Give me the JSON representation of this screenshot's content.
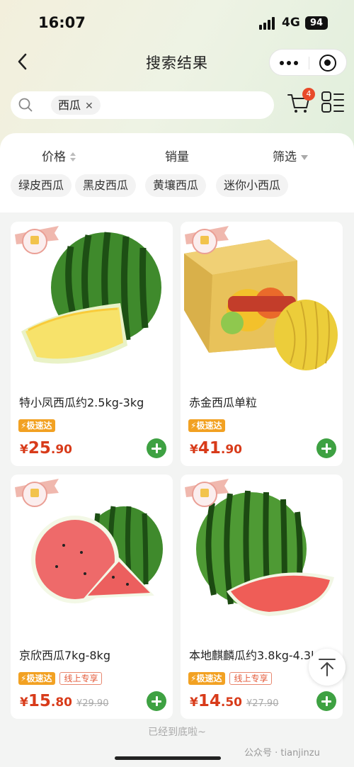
{
  "status": {
    "time": "16:07",
    "network": "4G",
    "battery": "94"
  },
  "nav": {
    "title": "搜索结果",
    "back_icon": "chevron-left-icon",
    "more_icon": "more-dots-icon",
    "close_icon": "target-close-icon"
  },
  "search": {
    "keyword": "西瓜",
    "clear_glyph": "✕",
    "icon": "search-icon"
  },
  "cart": {
    "badge": "4",
    "icon": "cart-icon"
  },
  "sort": {
    "price": "价格",
    "sales": "销量",
    "filter": "筛选"
  },
  "quick_tags": [
    "绿皮西瓜",
    "黑皮西瓜",
    "黄壤西瓜",
    "迷你小西瓜"
  ],
  "products": [
    {
      "title": "特小凤西瓜约2.5kg-3kg",
      "fast": "极速达",
      "online": "",
      "price_int": "25",
      "price_dec": ".90",
      "orig": "",
      "image": "yellow-flesh-watermelon"
    },
    {
      "title": "赤金西瓜单粒",
      "fast": "极速达",
      "online": "",
      "price_int": "41",
      "price_dec": ".90",
      "orig": "",
      "image": "golden-melon-box"
    },
    {
      "title": "京欣西瓜7kg-8kg",
      "fast": "极速达",
      "online": "线上专享",
      "price_int": "15",
      "price_dec": ".80",
      "orig": "¥29.90",
      "image": "red-flesh-watermelon"
    },
    {
      "title": "本地麒麟瓜约3.8kg-4.3kg",
      "fast": "极速达",
      "online": "线上专享",
      "price_int": "14",
      "price_dec": ".50",
      "orig": "¥27.90",
      "image": "striped-watermelon-slice"
    }
  ],
  "currency": "¥",
  "footer": "已经到底啦~",
  "watermark": "公众号 · tianjinzu",
  "colors": {
    "accent_green": "#3ea142",
    "price_red": "#d83b1a",
    "badge_orange": "#f2a122"
  }
}
